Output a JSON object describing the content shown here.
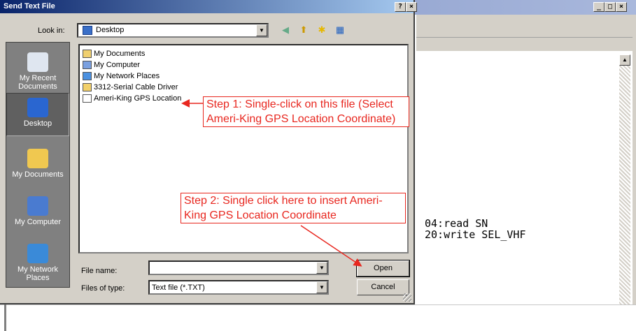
{
  "dialog": {
    "title": "Send Text File",
    "title_help": "?",
    "title_close": "×",
    "look_in_label": "Look in:",
    "look_in_value": "Desktop",
    "files": [
      {
        "name": "My Documents",
        "icon": "folder-docs-icon"
      },
      {
        "name": "My Computer",
        "icon": "computer-icon"
      },
      {
        "name": "My Network Places",
        "icon": "network-icon"
      },
      {
        "name": "3312-Serial Cable Driver",
        "icon": "folder-icon"
      },
      {
        "name": "Ameri-King GPS Location",
        "icon": "text-file-icon"
      }
    ],
    "places": [
      {
        "label": "My Recent Documents",
        "icon": "recent-docs-icon"
      },
      {
        "label": "Desktop",
        "icon": "desktop-icon",
        "selected": true
      },
      {
        "label": "My Documents",
        "icon": "my-documents-icon"
      },
      {
        "label": "My Computer",
        "icon": "my-computer-icon"
      },
      {
        "label": "My Network Places",
        "icon": "network-places-icon"
      }
    ],
    "file_name_label": "File name:",
    "file_name_value": "",
    "files_of_type_label": "Files of type:",
    "files_of_type_value": "Text file (*.TXT)",
    "open_button": "Open",
    "cancel_button": "Cancel"
  },
  "annotations": {
    "step1": "Step 1: Single-click on this file (Select Ameri-King GPS Location Coordinate)",
    "step2": "Step 2: Single click here to insert Ameri-King GPS Location Coordinate"
  },
  "background_window": {
    "console_lines": [
      "04:read SN",
      "20:write SEL_VHF"
    ]
  },
  "colors": {
    "annotation": "#e8271f",
    "titlebar_start": "#0a246a",
    "titlebar_end": "#a6caf0"
  }
}
